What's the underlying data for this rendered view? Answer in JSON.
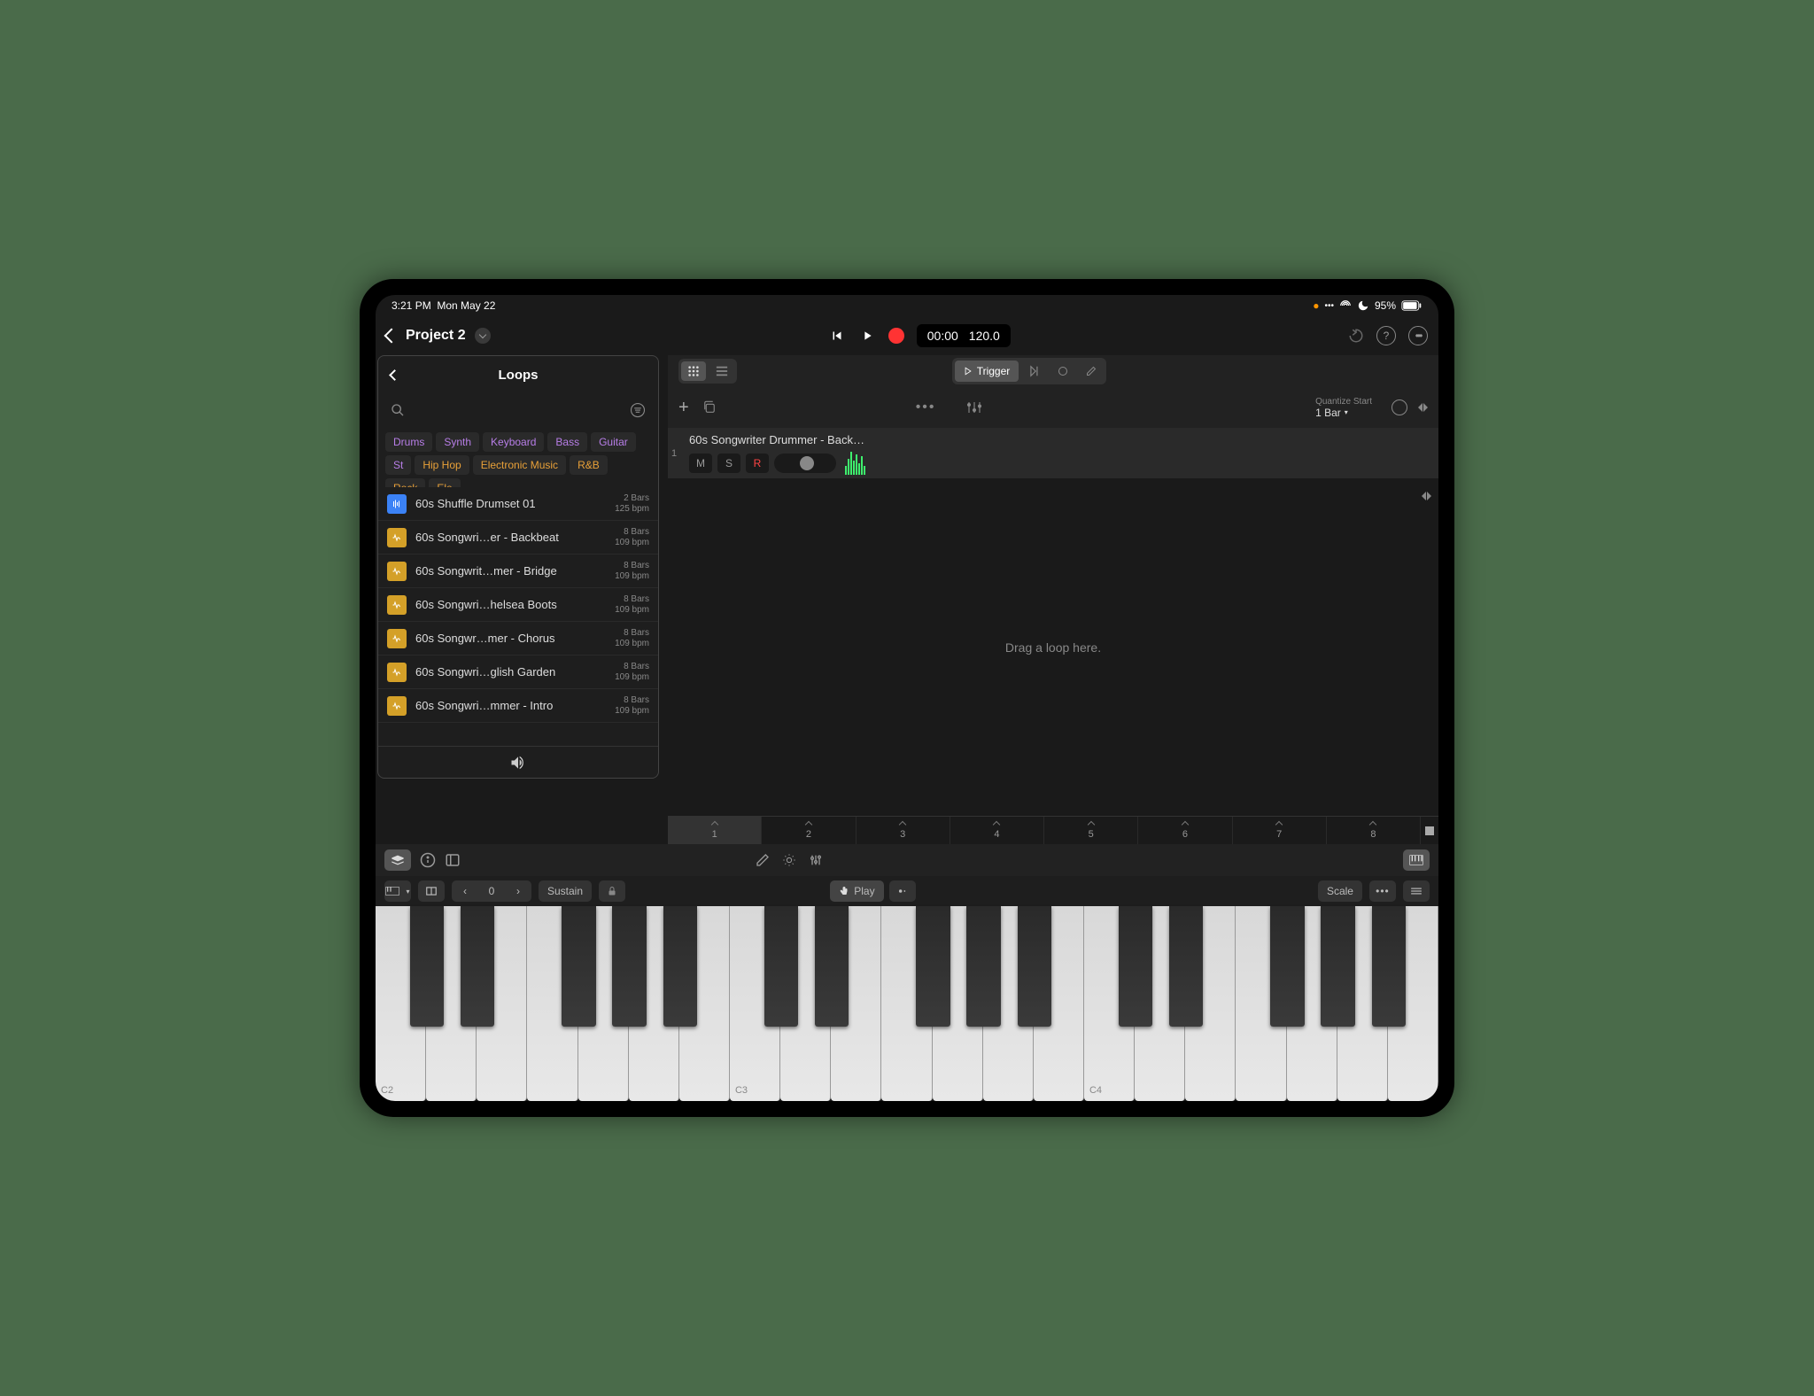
{
  "status": {
    "time": "3:21 PM",
    "date": "Mon May 22",
    "battery": "95%"
  },
  "project": {
    "name": "Project 2",
    "time": "00:00",
    "tempo": "120.0"
  },
  "toolbar": {
    "trigger": "Trigger"
  },
  "trackControls": {
    "quantize_label": "Quantize Start",
    "quantize_value": "1 Bar"
  },
  "loops": {
    "title": "Loops",
    "tags_row1": [
      "Drums",
      "Synth",
      "Keyboard",
      "Bass",
      "Guitar",
      "St"
    ],
    "tags_row2": [
      "Hip Hop",
      "Electronic Music",
      "R&B",
      "Rock",
      "Ele"
    ],
    "items": [
      {
        "name": "60s Shuffle Drumset 01",
        "bars": "2 Bars",
        "bpm": "125 bpm",
        "type": "blue"
      },
      {
        "name": "60s Songwri…er - Backbeat",
        "bars": "8 Bars",
        "bpm": "109 bpm",
        "type": "yellow"
      },
      {
        "name": "60s Songwrit…mer - Bridge",
        "bars": "8 Bars",
        "bpm": "109 bpm",
        "type": "yellow"
      },
      {
        "name": "60s Songwri…helsea Boots",
        "bars": "8 Bars",
        "bpm": "109 bpm",
        "type": "yellow"
      },
      {
        "name": "60s Songwr…mer - Chorus",
        "bars": "8 Bars",
        "bpm": "109 bpm",
        "type": "yellow"
      },
      {
        "name": "60s Songwri…glish Garden",
        "bars": "8 Bars",
        "bpm": "109 bpm",
        "type": "yellow"
      },
      {
        "name": "60s Songwri…mmer - Intro",
        "bars": "8 Bars",
        "bpm": "109 bpm",
        "type": "yellow"
      }
    ]
  },
  "track": {
    "num": "1",
    "name": "60s Songwriter Drummer - Back…",
    "mute": "M",
    "solo": "S",
    "rec": "R"
  },
  "dropZone": {
    "text": "Drag a loop here."
  },
  "scenes": [
    "1",
    "2",
    "3",
    "4",
    "5",
    "6",
    "7",
    "8"
  ],
  "kbd": {
    "sustain": "Sustain",
    "play": "Play",
    "scale": "Scale",
    "octave": "0",
    "labels": [
      "C2",
      "C3",
      "C4"
    ]
  }
}
